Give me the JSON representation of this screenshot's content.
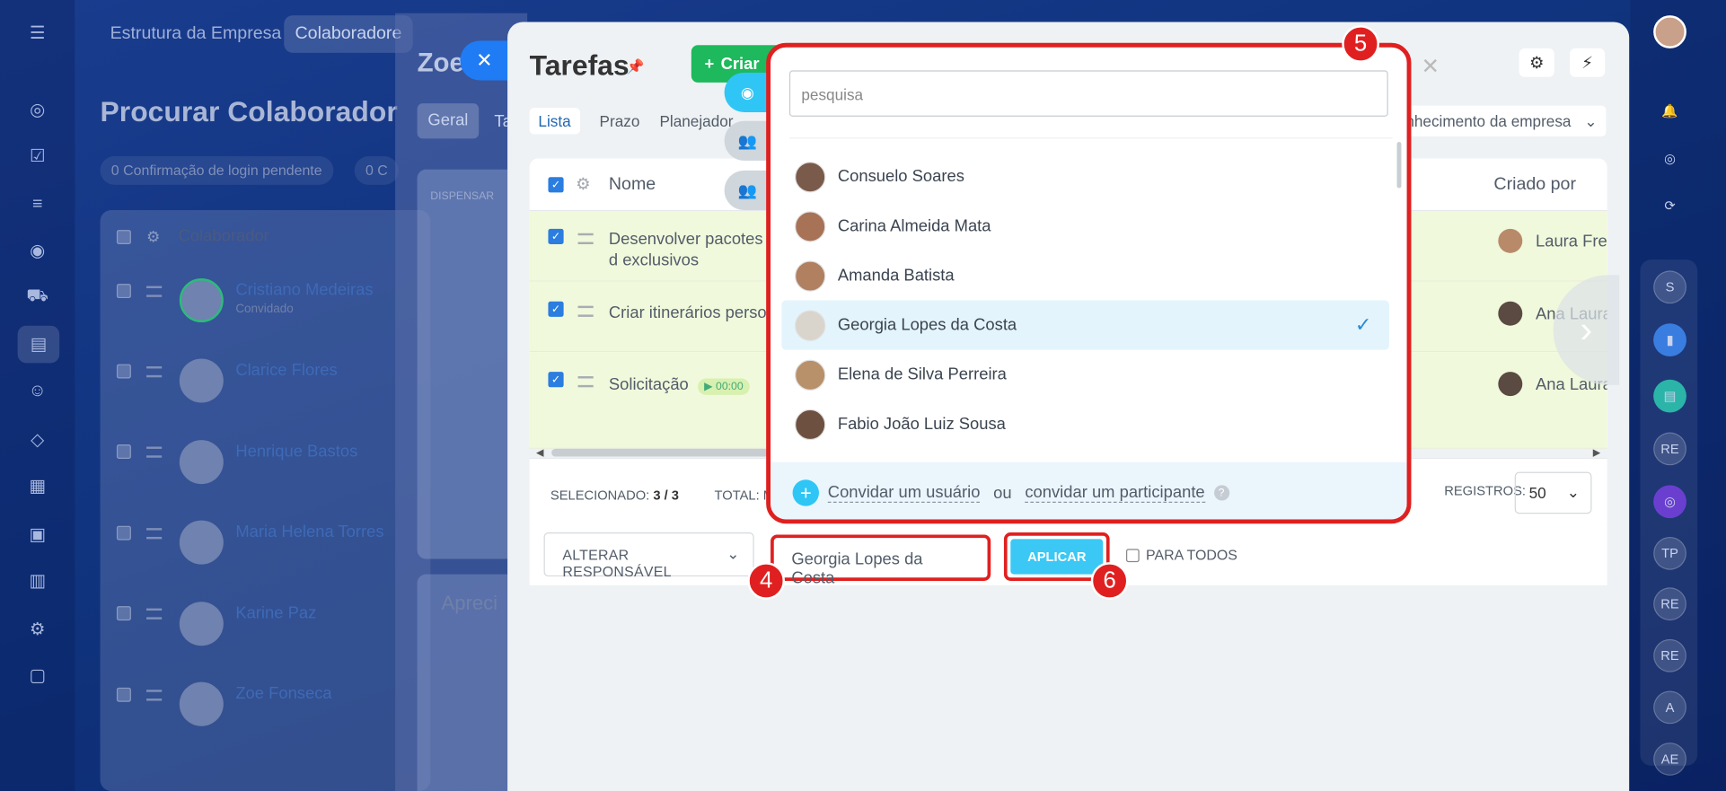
{
  "top_tabs": [
    "Estrutura da Empresa",
    "Colaboradore"
  ],
  "background_page": {
    "title": "Procurar Colaborador",
    "pills": [
      {
        "count": "0",
        "label": "Confirmação de login pendente"
      },
      {
        "count": "0",
        "label": "C"
      }
    ],
    "column_header": "Colaborador",
    "employees": [
      {
        "name": "Cristiano Medeiras",
        "sub": "Convidado"
      },
      {
        "name": "Clarice Flores",
        "sub": ""
      },
      {
        "name": "Henrique Bastos",
        "sub": ""
      },
      {
        "name": "Maria Helena Torres",
        "sub": ""
      },
      {
        "name": "Karine Paz",
        "sub": ""
      },
      {
        "name": "Zoe Fonseca",
        "sub": ""
      }
    ]
  },
  "zoe_panel": {
    "title": "Zoe",
    "tab": "Geral",
    "tab2": "Ta",
    "dismiss": "DISPENSAR",
    "appreciation": "Apreci"
  },
  "tasks": {
    "title": "Tarefas",
    "create_label": "Criar",
    "view_tabs": [
      "Lista",
      "Prazo",
      "Planejador"
    ],
    "filter_text": "nhecimento da empresa",
    "columns": {
      "name": "Nome",
      "creator": "Criado por"
    },
    "rows": [
      {
        "name": "Desenvolver pacotes d exclusivos",
        "creator": "Laura Freit",
        "timer": ""
      },
      {
        "name": "Criar itinerários person",
        "creator": "Ana Laura",
        "timer": ""
      },
      {
        "name": "Solicitação",
        "creator": "Ana Laura",
        "timer": "00:00"
      }
    ],
    "footer": {
      "selected_label": "SELECIONADO:",
      "selected_value": "3 / 3",
      "total_label": "TOTAL: M",
      "registros_label": "REGISTROS:",
      "per_page": "50"
    },
    "actions": {
      "alter_label": "ALTERAR RESPONSÁVEL",
      "user_value": "Georgia Lopes da Costa",
      "apply_label": "APLICAR",
      "for_all_label": "PARA TODOS"
    }
  },
  "popup": {
    "search_placeholder": "pesquisa",
    "users": [
      {
        "name": "Consuelo Soares",
        "selected": false
      },
      {
        "name": "Carina Almeida Mata",
        "selected": false
      },
      {
        "name": "Amanda Batista",
        "selected": false
      },
      {
        "name": "Georgia Lopes da Costa",
        "selected": true
      },
      {
        "name": "Elena de Silva Perreira",
        "selected": false
      },
      {
        "name": "Fabio João Luiz Sousa",
        "selected": false
      }
    ],
    "invite_user": "Convidar um usuário",
    "or": "ou",
    "invite_participant": "convidar um participante"
  },
  "badges": {
    "b4": "4",
    "b5": "5",
    "b6": "6"
  },
  "right_rail": [
    "S",
    "RE",
    "TP",
    "RE",
    "RE",
    "A",
    "AE"
  ],
  "colors": {
    "accent_red": "#e02020",
    "apply_blue": "#3bc8f5",
    "create_green": "#1db95c",
    "selected_row": "#e3f4fc"
  }
}
